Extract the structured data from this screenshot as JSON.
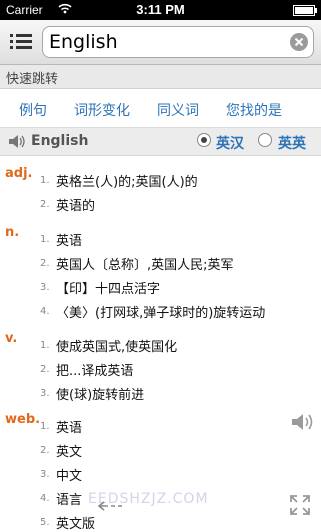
{
  "status_bar": {
    "carrier": "Carrier",
    "time": "3:11 PM",
    "icons": [
      "wifi-icon",
      "battery-icon"
    ]
  },
  "search": {
    "value": "English",
    "icons": [
      "menu-icon",
      "clear-icon"
    ]
  },
  "quick_jump": {
    "label": "快速跳转"
  },
  "links": [
    "例句",
    "词形变化",
    "同义词",
    "您找的是"
  ],
  "word_bar": {
    "headword": "English",
    "direction_options": [
      {
        "label": "英汉",
        "selected": true
      },
      {
        "label": "英英",
        "selected": false
      }
    ]
  },
  "entries": [
    {
      "pos": "adj.",
      "defs": [
        "英格兰(人)的;英国(人)的",
        "英语的"
      ]
    },
    {
      "pos": "n.",
      "defs": [
        "英语",
        "英国人〔总称〕,英国人民;英军",
        "【印】十四点活字",
        "〈美〉(打网球,弹子球时的)旋转运动"
      ]
    },
    {
      "pos": "v.",
      "defs": [
        "使成英国式,使英国化",
        "把...译成英语",
        "使(球)旋转前进"
      ]
    },
    {
      "pos": "web.",
      "defs": [
        "英语",
        "英文",
        "中文",
        "语言",
        "英文版"
      ]
    }
  ],
  "watermark": "EEDSHZJZ.COM",
  "colors": {
    "link": "#2b73b6",
    "pos": "#e06a1b",
    "status_bar": "#000000"
  }
}
